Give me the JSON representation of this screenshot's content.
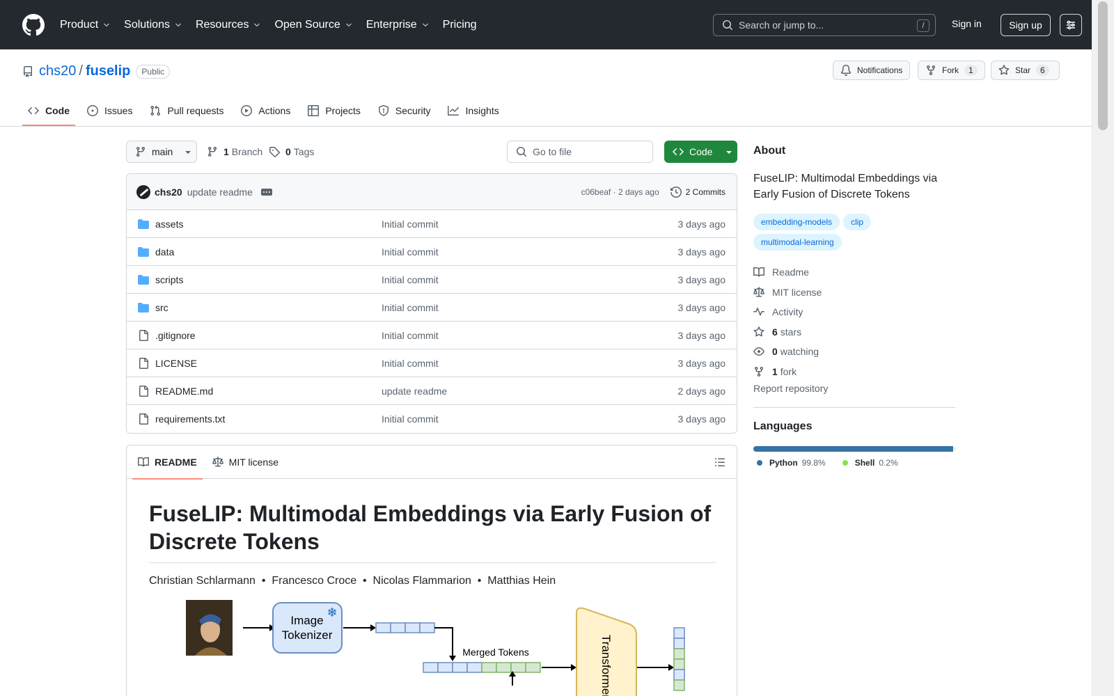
{
  "header": {
    "nav": [
      {
        "label": "Product",
        "dropdown": true
      },
      {
        "label": "Solutions",
        "dropdown": true
      },
      {
        "label": "Resources",
        "dropdown": true
      },
      {
        "label": "Open Source",
        "dropdown": true
      },
      {
        "label": "Enterprise",
        "dropdown": true
      },
      {
        "label": "Pricing",
        "dropdown": false
      }
    ],
    "search_placeholder": "Search or jump to...",
    "search_shortcut": "/",
    "sign_in": "Sign in",
    "sign_up": "Sign up"
  },
  "repo": {
    "owner": "chs20",
    "separator": "/",
    "name": "fuselip",
    "visibility": "Public",
    "notifications_label": "Notifications",
    "fork_label": "Fork",
    "fork_count": "1",
    "star_label": "Star",
    "star_count": "6",
    "tabs": [
      {
        "label": "Code",
        "icon": "code-icon",
        "active": true
      },
      {
        "label": "Issues",
        "icon": "issue-icon",
        "active": false
      },
      {
        "label": "Pull requests",
        "icon": "pull-request-icon",
        "active": false
      },
      {
        "label": "Actions",
        "icon": "play-icon",
        "active": false
      },
      {
        "label": "Projects",
        "icon": "table-icon",
        "active": false
      },
      {
        "label": "Security",
        "icon": "shield-icon",
        "active": false
      },
      {
        "label": "Insights",
        "icon": "graph-icon",
        "active": false
      }
    ]
  },
  "toolbar": {
    "branch": "main",
    "branch_count": "1",
    "branch_label": "Branch",
    "tag_count": "0",
    "tag_label": "Tags",
    "goto_placeholder": "Go to file",
    "code_button": "Code"
  },
  "latest_commit": {
    "author": "chs20",
    "message": "update readme",
    "sha": "c06beaf",
    "time": "2 days ago",
    "commits_label": "2 Commits"
  },
  "files": [
    {
      "name": "assets",
      "type": "dir",
      "message": "Initial commit",
      "date": "3 days ago"
    },
    {
      "name": "data",
      "type": "dir",
      "message": "Initial commit",
      "date": "3 days ago"
    },
    {
      "name": "scripts",
      "type": "dir",
      "message": "Initial commit",
      "date": "3 days ago"
    },
    {
      "name": "src",
      "type": "dir",
      "message": "Initial commit",
      "date": "3 days ago"
    },
    {
      "name": ".gitignore",
      "type": "file",
      "message": "Initial commit",
      "date": "3 days ago"
    },
    {
      "name": "LICENSE",
      "type": "file",
      "message": "Initial commit",
      "date": "3 days ago"
    },
    {
      "name": "README.md",
      "type": "file",
      "message": "update readme",
      "date": "2 days ago"
    },
    {
      "name": "requirements.txt",
      "type": "file",
      "message": "Initial commit",
      "date": "3 days ago"
    }
  ],
  "readme": {
    "tabs": [
      {
        "label": "README",
        "active": true
      },
      {
        "label": "MIT license",
        "active": false
      }
    ],
    "title": "FuseLIP: Multimodal Embeddings via Early Fusion of Discrete Tokens",
    "authors": "Christian Schlarmann  •  Francesco Croce  •  Nicolas Flammarion  •  Matthias Hein",
    "figure": {
      "tokenizer_label_1": "Image",
      "tokenizer_label_2": "Tokenizer",
      "merged_label": "Merged Tokens",
      "transformer_label": "Transformer"
    }
  },
  "about": {
    "heading": "About",
    "description": "FuseLIP: Multimodal Embeddings via Early Fusion of Discrete Tokens",
    "topics": [
      "embedding-models",
      "clip",
      "multimodal-learning"
    ],
    "links": [
      {
        "icon": "book-icon",
        "count": "",
        "label": "Readme"
      },
      {
        "icon": "law-icon",
        "count": "",
        "label": "MIT license"
      },
      {
        "icon": "pulse-icon",
        "count": "",
        "label": "Activity"
      },
      {
        "icon": "star-icon",
        "count": "6",
        "label": "stars"
      },
      {
        "icon": "eye-icon",
        "count": "0",
        "label": "watching"
      },
      {
        "icon": "fork-icon",
        "count": "1",
        "label": "fork"
      }
    ],
    "report": "Report repository"
  },
  "languages": {
    "heading": "Languages",
    "items": [
      {
        "name": "Python",
        "percent": "99.8%",
        "share": 99.8,
        "color": "#3572A5"
      },
      {
        "name": "Shell",
        "percent": "0.2%",
        "share": 0.2,
        "color": "#89e051"
      }
    ]
  },
  "colors": {
    "header_bg": "#24292f",
    "link": "#0969da",
    "primary_button": "#1f883d",
    "active_tab_underline": "#fd8c73",
    "folder": "#54aeff"
  }
}
